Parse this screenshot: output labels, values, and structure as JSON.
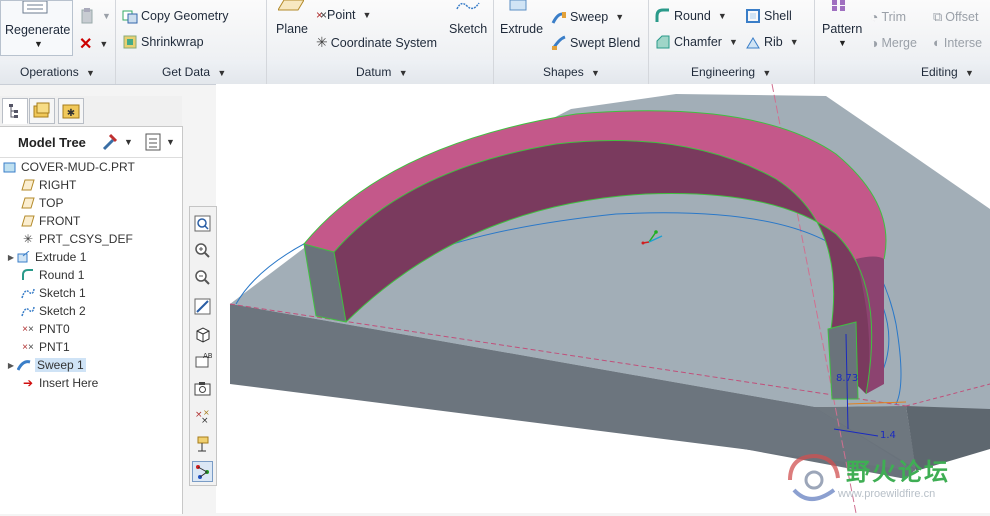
{
  "ribbon": {
    "regenerate": "Regenerate",
    "copy_geometry": "Copy Geometry",
    "shrinkwrap": "Shrinkwrap",
    "plane": "Plane",
    "point": "Point",
    "coordinate_system": "Coordinate System",
    "sketch": "Sketch",
    "extrude": "Extrude",
    "sweep": "Sweep",
    "swept_blend": "Swept Blend",
    "round": "Round",
    "shell": "Shell",
    "chamfer": "Chamfer",
    "rib": "Rib",
    "pattern": "Pattern",
    "trim": "Trim",
    "offset": "Offset",
    "merge": "Merge",
    "intersect": "Interse"
  },
  "groups": {
    "operations": "Operations",
    "get_data": "Get Data",
    "datum": "Datum",
    "shapes": "Shapes",
    "engineering": "Engineering",
    "editing": "Editing"
  },
  "model_tree": {
    "title": "Model Tree",
    "items": [
      {
        "label": "COVER-MUD-C.PRT",
        "icon": "part-icon"
      },
      {
        "label": "RIGHT",
        "icon": "datum-plane-icon"
      },
      {
        "label": "TOP",
        "icon": "datum-plane-icon"
      },
      {
        "label": "FRONT",
        "icon": "datum-plane-icon"
      },
      {
        "label": "PRT_CSYS_DEF",
        "icon": "csys-icon"
      },
      {
        "label": "Extrude 1",
        "icon": "extrude-icon"
      },
      {
        "label": "Round 1",
        "icon": "round-icon"
      },
      {
        "label": "Sketch 1",
        "icon": "sketch-icon"
      },
      {
        "label": "Sketch 2",
        "icon": "sketch-icon"
      },
      {
        "label": "PNT0",
        "icon": "point-icon"
      },
      {
        "label": "PNT1",
        "icon": "point-icon"
      },
      {
        "label": "Sweep 1",
        "icon": "sweep-icon"
      },
      {
        "label": "Insert Here",
        "icon": "insert-arrow-icon"
      }
    ]
  },
  "dimensions": {
    "d1": "1.4",
    "d2": "8.73"
  },
  "watermark": {
    "title": "野火论坛",
    "url": "www.proewildfire.cn"
  },
  "colors": {
    "accent_pink": "#c4588a",
    "solid_gray": "#7b848c",
    "edge_green": "#40c040"
  }
}
